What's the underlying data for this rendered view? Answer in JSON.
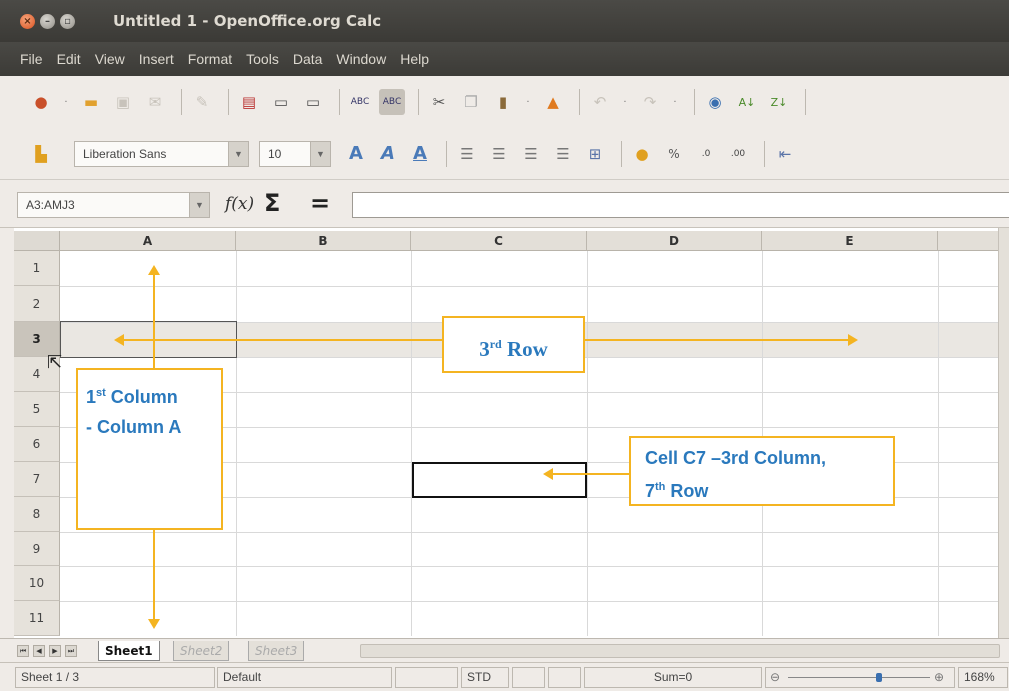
{
  "window": {
    "title": "Untitled 1 - OpenOffice.org Calc"
  },
  "menu": {
    "items": [
      "File",
      "Edit",
      "View",
      "Insert",
      "Format",
      "Tools",
      "Data",
      "Window",
      "Help"
    ]
  },
  "format_toolbar": {
    "font_name": "Liberation Sans",
    "font_size": "10"
  },
  "formula_bar": {
    "name_box": "A3:AMJ3",
    "fx_label": "f(x)",
    "sum_symbol": "Σ",
    "equals_symbol": "=",
    "formula": ""
  },
  "grid": {
    "columns": [
      "A",
      "B",
      "C",
      "D",
      "E"
    ],
    "rows": [
      "1",
      "2",
      "3",
      "4",
      "5",
      "6",
      "7",
      "8",
      "9",
      "10",
      "11"
    ],
    "selected_row": "3"
  },
  "annotations": {
    "column_label_line1_num": "1",
    "column_label_line1_sup": "st",
    "column_label_line1_rest": " Column",
    "column_label_line2": "- Column A",
    "row_label_num": "3",
    "row_label_sup": "rd",
    "row_label_rest": " Row",
    "cell_label_line1": "Cell C7 –3rd Column,",
    "cell_label_line2_num": "7",
    "cell_label_line2_sup": "th",
    "cell_label_line2_rest": " Row",
    "accent_color": "#f4b421",
    "text_color": "#2a79bd"
  },
  "sheet_tabs": {
    "tabs": [
      "Sheet1",
      "Sheet2",
      "Sheet3"
    ],
    "active": "Sheet1"
  },
  "status_bar": {
    "sheet": "Sheet 1 / 3",
    "page_style": "Default",
    "mode": "STD",
    "sum": "Sum=0",
    "zoom": "168%"
  }
}
